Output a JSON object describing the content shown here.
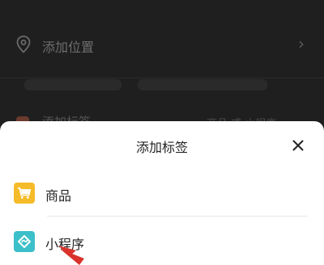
{
  "background": {
    "location_label": "添加位置",
    "tag_label": "添加标签",
    "tag_right_text": "商品 或 小程序"
  },
  "sheet": {
    "title": "添加标签",
    "options": [
      {
        "label": "商品",
        "icon": "cart-icon",
        "color": "#f6bb2a"
      },
      {
        "label": "小程序",
        "icon": "mini-program-icon",
        "color": "#3bbfc9"
      }
    ]
  },
  "colors": {
    "annotation_arrow": "#d9332b"
  }
}
